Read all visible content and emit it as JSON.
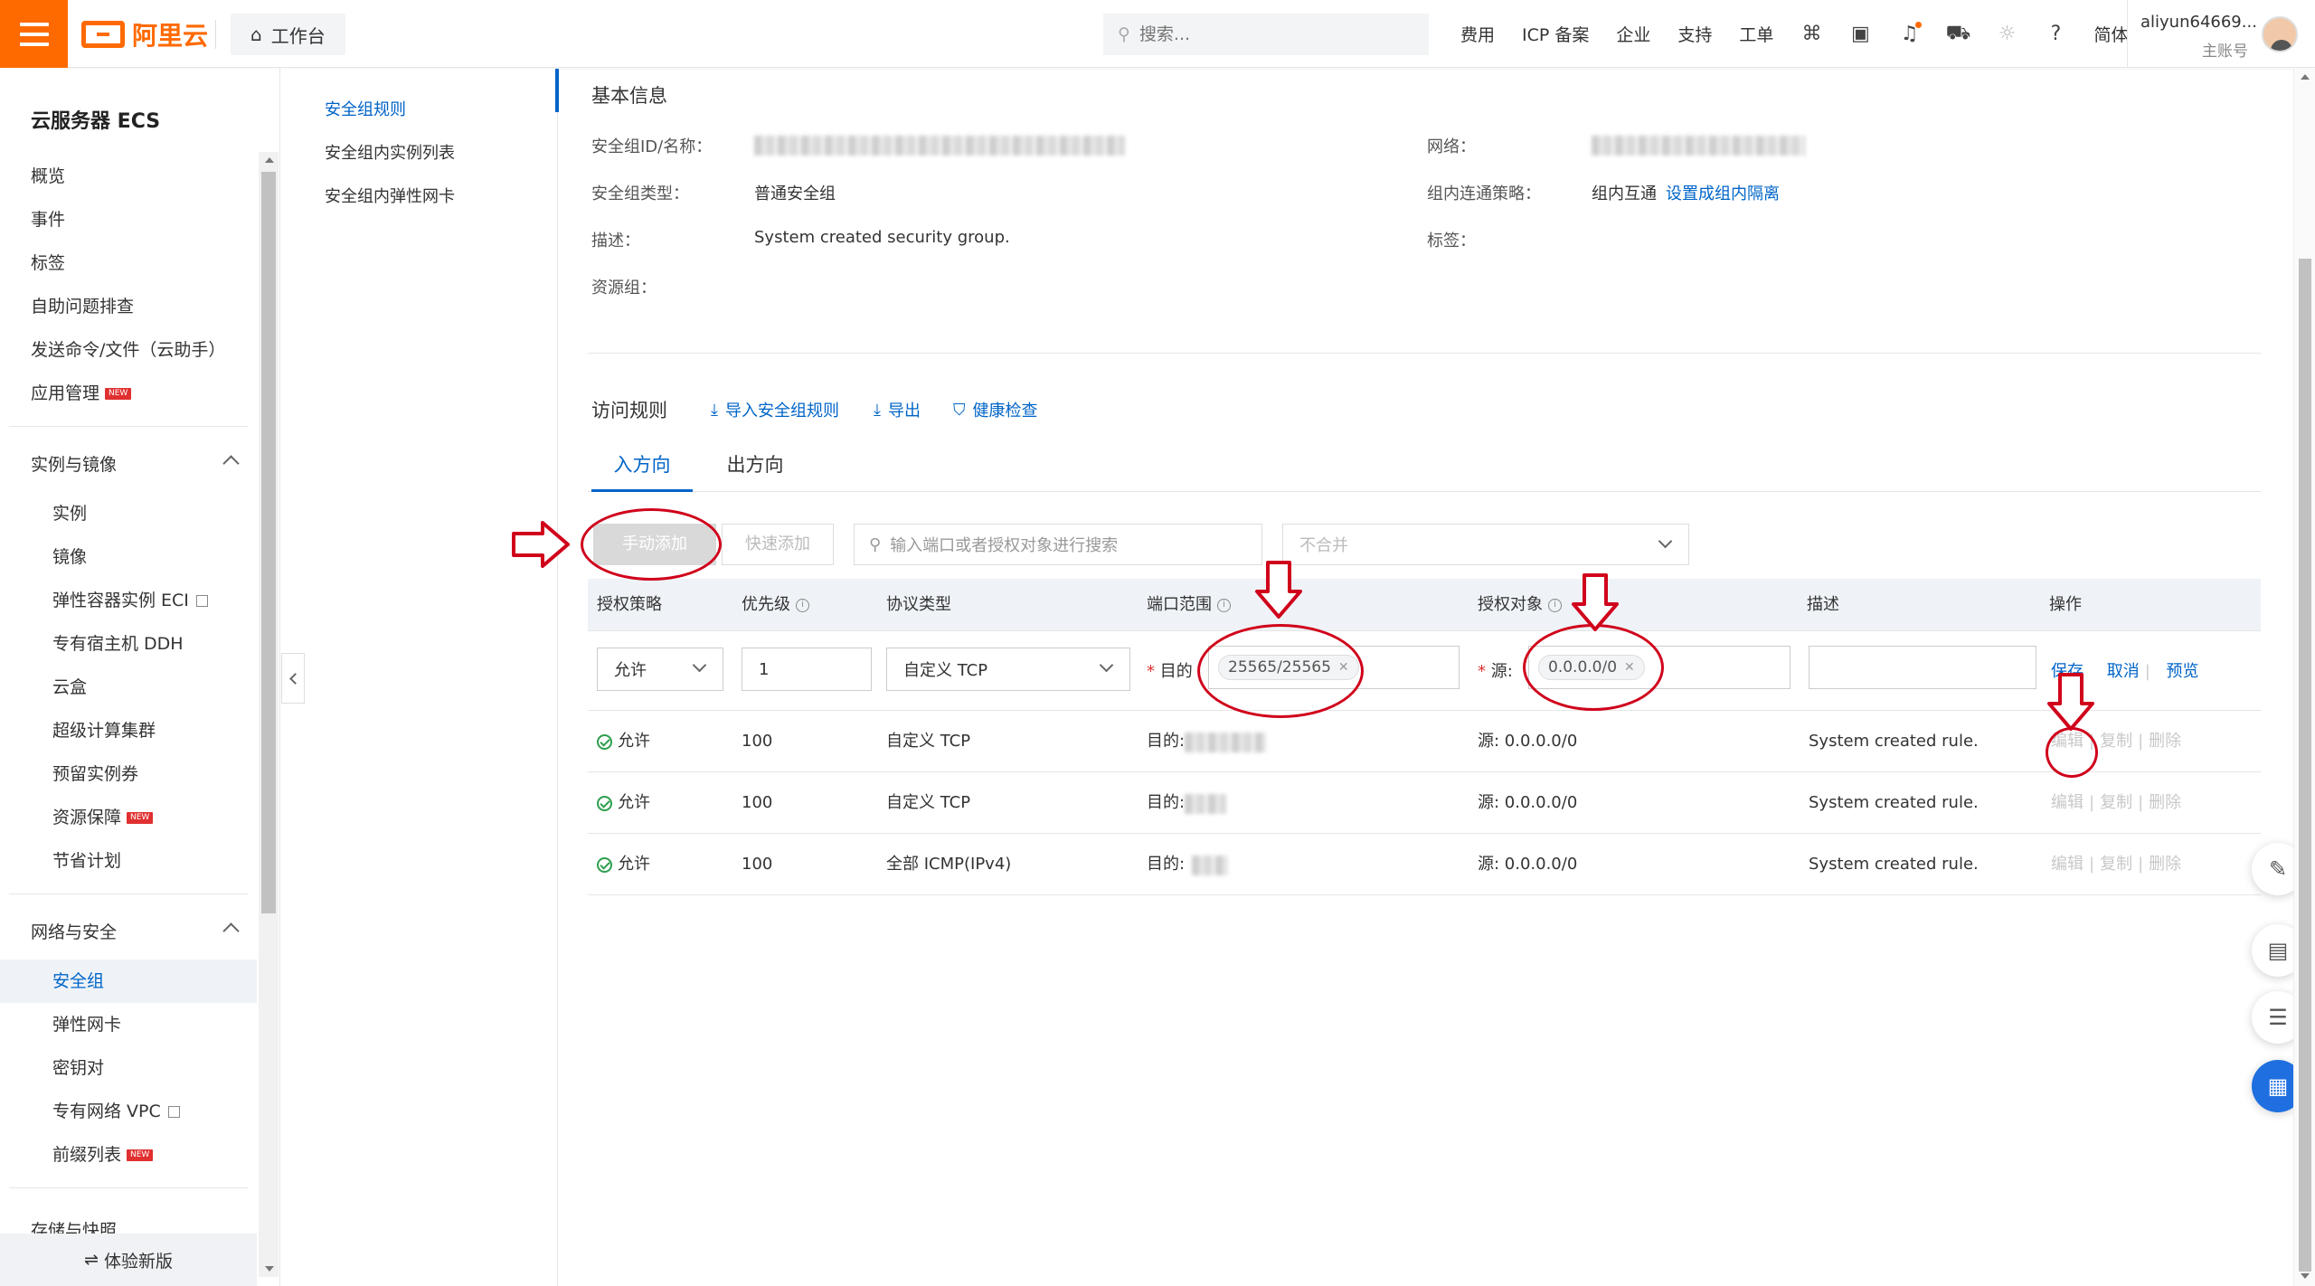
{
  "topbar": {
    "logo_text": "阿里云",
    "workbench": "工作台",
    "search_placeholder": "搜索...",
    "nav": [
      "费用",
      "ICP 备案",
      "企业",
      "支持",
      "工单"
    ],
    "lang": "简体",
    "account_name": "aliyun64669...",
    "account_sub": "主账号"
  },
  "sidebar": {
    "title": "云服务器 ECS",
    "top_items": [
      "概览",
      "事件",
      "标签",
      "自助问题排查",
      "发送命令/文件（云助手）",
      "应用管理"
    ],
    "new_badge": "NEW",
    "group1": "实例与镜像",
    "group1_items": [
      "实例",
      "镜像",
      "弹性容器实例 ECI",
      "专有宿主机 DDH",
      "云盒",
      "超级计算集群",
      "预留实例券",
      "资源保障",
      "节省计划"
    ],
    "group2": "网络与安全",
    "group2_items": [
      "安全组",
      "弹性网卡",
      "密钥对",
      "专有网络 VPC",
      "前缀列表"
    ],
    "group3_partial": "存储与快照",
    "bottom": "体验新版"
  },
  "subnav": [
    "安全组规则",
    "安全组内实例列表",
    "安全组内弹性网卡"
  ],
  "basic_info": {
    "title": "基本信息",
    "labels": {
      "id_name": "安全组ID/名称：",
      "type": "安全组类型：",
      "desc": "描述：",
      "resgroup": "资源组：",
      "network": "网络：",
      "policy": "组内连通策略：",
      "tags": "标签："
    },
    "type_value": "普通安全组",
    "desc_value": "System created security group.",
    "policy_value": "组内互通",
    "policy_link": "设置成组内隔离"
  },
  "access_rules": {
    "title": "访问规则",
    "import": "导入安全组规则",
    "export": "导出",
    "health": "健康检查",
    "tabs": [
      "入方向",
      "出方向"
    ],
    "manual_add": "手动添加",
    "quick_add": "快速添加",
    "search_placeholder": "输入端口或者授权对象进行搜索",
    "merge_select": "不合并",
    "columns": [
      "授权策略",
      "优先级",
      "协议类型",
      "端口范围",
      "授权对象",
      "描述",
      "操作"
    ]
  },
  "edit_row": {
    "policy": "允许",
    "priority": "1",
    "protocol": "自定义 TCP",
    "dest_label": "目的",
    "port_tag": "25565/25565",
    "src_label": "源:",
    "source_tag": "0.0.0.0/0",
    "save": "保存",
    "cancel": "取消",
    "preview": "预览"
  },
  "rules": [
    {
      "policy": "允许",
      "priority": "100",
      "protocol": "自定义 TCP",
      "dest": "目的:",
      "source": "源: 0.0.0.0/0",
      "desc": "System created rule."
    },
    {
      "policy": "允许",
      "priority": "100",
      "protocol": "自定义 TCP",
      "dest": "目的:",
      "source": "源: 0.0.0.0/0",
      "desc": "System created rule."
    },
    {
      "policy": "允许",
      "priority": "100",
      "protocol": "全部 ICMP(IPv4)",
      "dest": "目的:",
      "source": "源: 0.0.0.0/0",
      "desc": "System created rule."
    }
  ],
  "row_ops": [
    "编辑",
    "复制",
    "删除"
  ],
  "colors": {
    "accent": "#0064c8",
    "brand": "#ff6a00",
    "annotation": "#d0021b"
  }
}
